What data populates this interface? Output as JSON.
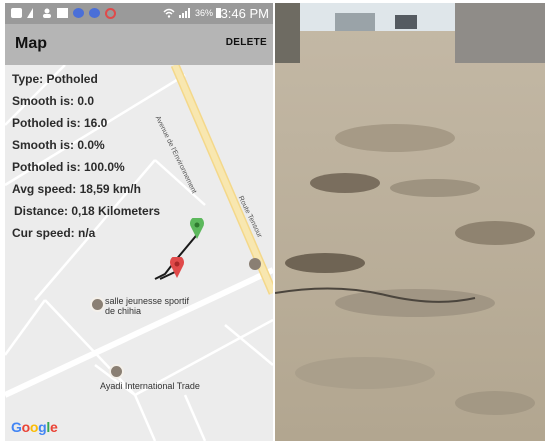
{
  "status_bar": {
    "icons": [
      "message-icon",
      "signal-icon",
      "person-icon",
      "image-icon",
      "vk-icon",
      "vk-icon",
      "blocked-icon",
      "wifi-icon",
      "cell-signal-icon"
    ],
    "battery_text": "36%",
    "time": "3:46 PM"
  },
  "app_bar": {
    "title": "Map",
    "delete_label": "DELETE"
  },
  "stats": {
    "type": "Type: Potholed",
    "smooth_is": "Smooth is: 0.0",
    "potholed_is": "Potholed is: 16.0",
    "smooth_pct": "Smooth is: 0.0%",
    "potholed_pct": "Potholed is: 100.0%",
    "avg_speed": "Avg speed: 18,59 km/h",
    "distance": "Distance: 0,18 Kilometers",
    "cur_speed": "Cur speed: n/a"
  },
  "map": {
    "street_1": "Avenue de l'Environnement",
    "street_2": "Route Tensour",
    "poi_1": "salle jeunesse sportif de chihia",
    "poi_2": "Ayadi International Trade",
    "google_logo": "Google",
    "colors": {
      "map_bg": "#ececec",
      "major_road": "#f7e3a0",
      "minor_road": "#ffffff",
      "start_marker": "#5cb85c",
      "end_marker": "#e04a4a",
      "track": "#1a1a1a"
    }
  },
  "photo": {
    "colors": {
      "sky": "#dfe6ea",
      "road": "#b7aa96",
      "wall": "#8f8c88"
    }
  }
}
